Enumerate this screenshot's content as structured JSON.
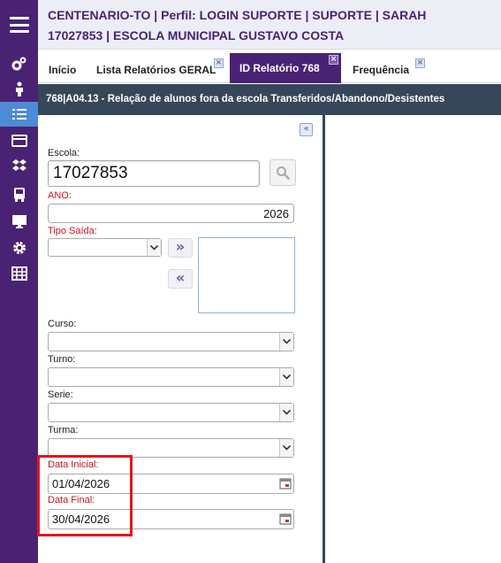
{
  "header": {
    "line1": "CENTENARIO-TO | Perfil: LOGIN SUPORTE | SUPORTE | SARAH",
    "line2": "17027853 | ESCOLA MUNICIPAL GUSTAVO COSTA"
  },
  "sidebar": {
    "items": [
      {
        "icon": "gears-icon"
      },
      {
        "icon": "person-icon"
      },
      {
        "icon": "list-icon",
        "active": true
      },
      {
        "icon": "card-icon"
      },
      {
        "icon": "dropbox-icon"
      },
      {
        "icon": "bus-icon"
      },
      {
        "icon": "monitor-icon"
      },
      {
        "icon": "gear-icon"
      },
      {
        "icon": "table-icon"
      }
    ]
  },
  "tabs": [
    {
      "label": "Início",
      "closable": false
    },
    {
      "label": "Lista Relatórios GERAL",
      "closable": true
    },
    {
      "label": "ID Relatório 768",
      "closable": true,
      "active": true
    },
    {
      "label": "Frequência",
      "closable": true
    }
  ],
  "report": {
    "title": "768|A04.13 - Relação de alunos fora da escola Transferidos/Abandono/Desistentes"
  },
  "form": {
    "escola": {
      "label": "Escola:",
      "value": "17027853"
    },
    "ano": {
      "label": "ANO:",
      "value": "2026"
    },
    "tipo_saida": {
      "label": "Tipo Saída:",
      "value": ""
    },
    "curso": {
      "label": "Curso:",
      "value": ""
    },
    "turno": {
      "label": "Turno:",
      "value": ""
    },
    "serie": {
      "label": "Serie:",
      "value": ""
    },
    "turma": {
      "label": "Turma:",
      "value": ""
    },
    "data_inicial": {
      "label": "Data Inicial:",
      "value": "01/04/2026"
    },
    "data_final": {
      "label": "Data Final:",
      "value": "30/04/2026"
    }
  },
  "buttons": {
    "collapse": "«",
    "move_right": "»",
    "move_left": "«"
  },
  "colors": {
    "sidebar": "#4a2274",
    "accent": "#4d8bd6",
    "title_bar": "#37475a",
    "required_label": "#d0121b",
    "highlight": "#e8141e"
  }
}
